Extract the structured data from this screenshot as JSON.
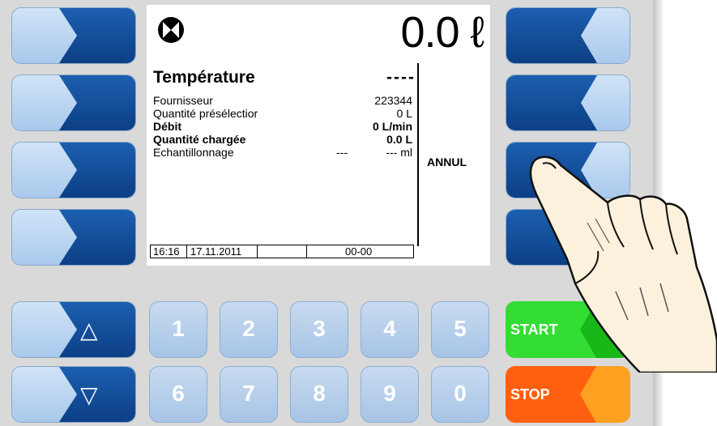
{
  "screen": {
    "volume": "0.0 ℓ",
    "title": "Température",
    "title_value": "----",
    "rows": [
      {
        "label": "Fournisseur",
        "v1": "",
        "v2": "223344",
        "bold": false
      },
      {
        "label": "Quantité présélectior",
        "v1": "",
        "v2": "0 L",
        "bold": false
      },
      {
        "label": "Débit",
        "v1": "",
        "v2": "0 L/min",
        "bold": true
      },
      {
        "label": "Quantité chargée",
        "v1": "",
        "v2": "0.0 L",
        "bold": true
      },
      {
        "label": "Echantillonnage",
        "v1": "---",
        "v2": "---  ml",
        "bold": false
      }
    ],
    "annul": "ANNUL",
    "footer": {
      "time": "16:16",
      "date": "17.11.2011",
      "code": "00-00"
    }
  },
  "keys": {
    "up": "△",
    "down": "▽",
    "digits_top": [
      "1",
      "2",
      "3",
      "4",
      "5"
    ],
    "digits_bottom": [
      "6",
      "7",
      "8",
      "9",
      "0"
    ],
    "start": "START",
    "stop": "STOP"
  },
  "colors": {
    "softkey_dark": "#1c5fb0",
    "softkey_light": "#b9d3ef",
    "start_green": "#2ecc2e",
    "stop_orange": "#ff6600"
  }
}
